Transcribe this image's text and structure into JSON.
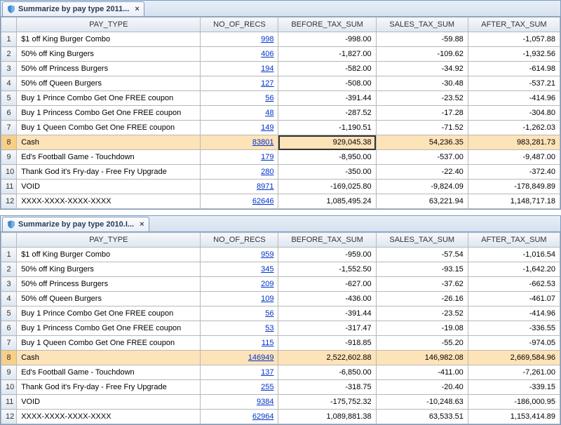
{
  "panels": [
    {
      "tab_title": "Summarize by pay type 2011...",
      "columns": [
        "PAY_TYPE",
        "NO_OF_RECS",
        "BEFORE_TAX_SUM",
        "SALES_TAX_SUM",
        "AFTER_TAX_SUM"
      ],
      "selected_row_index": 7,
      "active_col": "before_tax",
      "rows": [
        {
          "n": "1",
          "pay": "$1 off King Burger Combo",
          "recs": "998",
          "bt": "-998.00",
          "st": "-59.88",
          "at": "-1,057.88"
        },
        {
          "n": "2",
          "pay": "50% off King Burgers",
          "recs": "406",
          "bt": "-1,827.00",
          "st": "-109.62",
          "at": "-1,932.56"
        },
        {
          "n": "3",
          "pay": "50% off Princess Burgers",
          "recs": "194",
          "bt": "-582.00",
          "st": "-34.92",
          "at": "-614.98"
        },
        {
          "n": "4",
          "pay": "50% off Queen Burgers",
          "recs": "127",
          "bt": "-508.00",
          "st": "-30.48",
          "at": "-537.21"
        },
        {
          "n": "5",
          "pay": "Buy 1 Prince Combo Get One FREE coupon",
          "recs": "56",
          "bt": "-391.44",
          "st": "-23.52",
          "at": "-414.96"
        },
        {
          "n": "6",
          "pay": "Buy 1 Princess Combo Get One FREE coupon",
          "recs": "48",
          "bt": "-287.52",
          "st": "-17.28",
          "at": "-304.80"
        },
        {
          "n": "7",
          "pay": "Buy 1 Queen Combo Get One FREE coupon",
          "recs": "149",
          "bt": "-1,190.51",
          "st": "-71.52",
          "at": "-1,262.03"
        },
        {
          "n": "8",
          "pay": "Cash",
          "recs": "83801",
          "bt": "929,045.38",
          "st": "54,236.35",
          "at": "983,281.73"
        },
        {
          "n": "9",
          "pay": "Ed's Football Game - Touchdown",
          "recs": "179",
          "bt": "-8,950.00",
          "st": "-537.00",
          "at": "-9,487.00"
        },
        {
          "n": "10",
          "pay": "Thank God it's Fry-day - Free Fry Upgrade",
          "recs": "280",
          "bt": "-350.00",
          "st": "-22.40",
          "at": "-372.40"
        },
        {
          "n": "11",
          "pay": "VOID",
          "recs": "8971",
          "bt": "-169,025.80",
          "st": "-9,824.09",
          "at": "-178,849.89"
        },
        {
          "n": "12",
          "pay": "XXXX-XXXX-XXXX-XXXX",
          "recs": "62646",
          "bt": "1,085,495.24",
          "st": "63,221.94",
          "at": "1,148,717.18"
        }
      ]
    },
    {
      "tab_title": "Summarize by pay type 2010.I...",
      "columns": [
        "PAY_TYPE",
        "NO_OF_RECS",
        "BEFORE_TAX_SUM",
        "SALES_TAX_SUM",
        "AFTER_TAX_SUM"
      ],
      "selected_row_index": 7,
      "active_col": null,
      "rows": [
        {
          "n": "1",
          "pay": "$1 off King Burger Combo",
          "recs": "959",
          "bt": "-959.00",
          "st": "-57.54",
          "at": "-1,016.54"
        },
        {
          "n": "2",
          "pay": "50% off King Burgers",
          "recs": "345",
          "bt": "-1,552.50",
          "st": "-93.15",
          "at": "-1,642.20"
        },
        {
          "n": "3",
          "pay": "50% off Princess Burgers",
          "recs": "209",
          "bt": "-627.00",
          "st": "-37.62",
          "at": "-662.53"
        },
        {
          "n": "4",
          "pay": "50% off Queen Burgers",
          "recs": "109",
          "bt": "-436.00",
          "st": "-26.16",
          "at": "-461.07"
        },
        {
          "n": "5",
          "pay": "Buy 1 Prince Combo Get One FREE coupon",
          "recs": "56",
          "bt": "-391.44",
          "st": "-23.52",
          "at": "-414.96"
        },
        {
          "n": "6",
          "pay": "Buy 1 Princess Combo Get One FREE coupon",
          "recs": "53",
          "bt": "-317.47",
          "st": "-19.08",
          "at": "-336.55"
        },
        {
          "n": "7",
          "pay": "Buy 1 Queen Combo Get One FREE coupon",
          "recs": "115",
          "bt": "-918.85",
          "st": "-55.20",
          "at": "-974.05"
        },
        {
          "n": "8",
          "pay": "Cash",
          "recs": "146949",
          "bt": "2,522,602.88",
          "st": "146,982.08",
          "at": "2,669,584.96"
        },
        {
          "n": "9",
          "pay": "Ed's Football Game - Touchdown",
          "recs": "137",
          "bt": "-6,850.00",
          "st": "-411.00",
          "at": "-7,261.00"
        },
        {
          "n": "10",
          "pay": "Thank God it's Fry-day - Free Fry Upgrade",
          "recs": "255",
          "bt": "-318.75",
          "st": "-20.40",
          "at": "-339.15"
        },
        {
          "n": "11",
          "pay": "VOID",
          "recs": "9384",
          "bt": "-175,752.32",
          "st": "-10,248.63",
          "at": "-186,000.95"
        },
        {
          "n": "12",
          "pay": "XXXX-XXXX-XXXX-XXXX",
          "recs": "62964",
          "bt": "1,089,881.38",
          "st": "63,533.51",
          "at": "1,153,414.89"
        }
      ]
    }
  ]
}
